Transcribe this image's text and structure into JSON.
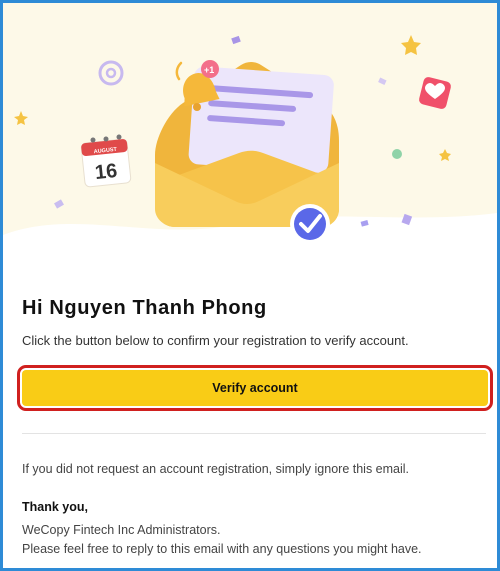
{
  "hero": {
    "calendar_month": "AUGUST",
    "calendar_day": "16",
    "bell_badge": "+1",
    "colors": {
      "background": "#fdf9e8",
      "envelope": "#f6c34a",
      "letter": "#ece6fb",
      "check": "#5a68e8",
      "star": "#f5c342"
    }
  },
  "email": {
    "greeting": "Hi Nguyen Thanh Phong",
    "intro": "Click the button below to confirm your registration to verify account.",
    "cta_label": "Verify account",
    "ignore_note": "If you did not request an account registration, simply ignore this email.",
    "thanks": "Thank you,",
    "signature_org": "WeCopy Fintech Inc Administrators.",
    "signature_help": "Please feel free to reply to this email with any questions you might have."
  },
  "colors": {
    "frame": "#2e8bd6",
    "cta_background": "#f9cc16",
    "cta_highlight": "#d0201f"
  }
}
